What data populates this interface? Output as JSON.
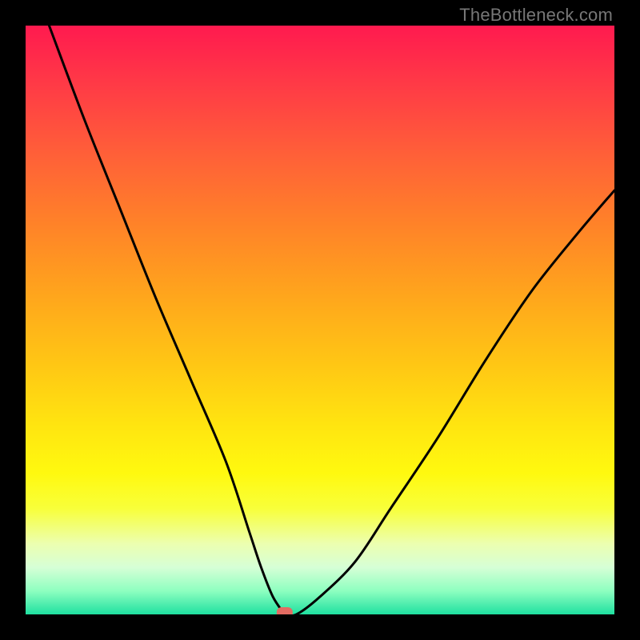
{
  "watermark": "TheBottleneck.com",
  "chart_data": {
    "type": "line",
    "title": "",
    "xlabel": "",
    "ylabel": "",
    "xlim": [
      0,
      100
    ],
    "ylim": [
      0,
      100
    ],
    "grid": false,
    "legend": false,
    "series": [
      {
        "name": "curve",
        "x": [
          4,
          10,
          16,
          22,
          28,
          34,
          38,
          40,
          42,
          44,
          44,
          46,
          50,
          56,
          62,
          70,
          78,
          86,
          94,
          100
        ],
        "y": [
          100,
          84,
          69,
          54,
          40,
          26,
          14,
          8,
          3,
          0,
          0,
          0,
          3,
          9,
          18,
          30,
          43,
          55,
          65,
          72
        ]
      }
    ],
    "marker": {
      "x": 44,
      "y": 0,
      "color": "#e36b62"
    },
    "gradient_stops": [
      {
        "pos": 0,
        "color": "#ff1a4f"
      },
      {
        "pos": 10,
        "color": "#ff3a46"
      },
      {
        "pos": 22,
        "color": "#ff6038"
      },
      {
        "pos": 34,
        "color": "#ff8328"
      },
      {
        "pos": 46,
        "color": "#ffa61c"
      },
      {
        "pos": 58,
        "color": "#ffc814"
      },
      {
        "pos": 68,
        "color": "#ffe510"
      },
      {
        "pos": 76,
        "color": "#fff90f"
      },
      {
        "pos": 82,
        "color": "#f8ff3a"
      },
      {
        "pos": 88,
        "color": "#ecffb0"
      },
      {
        "pos": 92,
        "color": "#d6ffd6"
      },
      {
        "pos": 96,
        "color": "#8effc0"
      },
      {
        "pos": 100,
        "color": "#1fe0a0"
      }
    ]
  }
}
